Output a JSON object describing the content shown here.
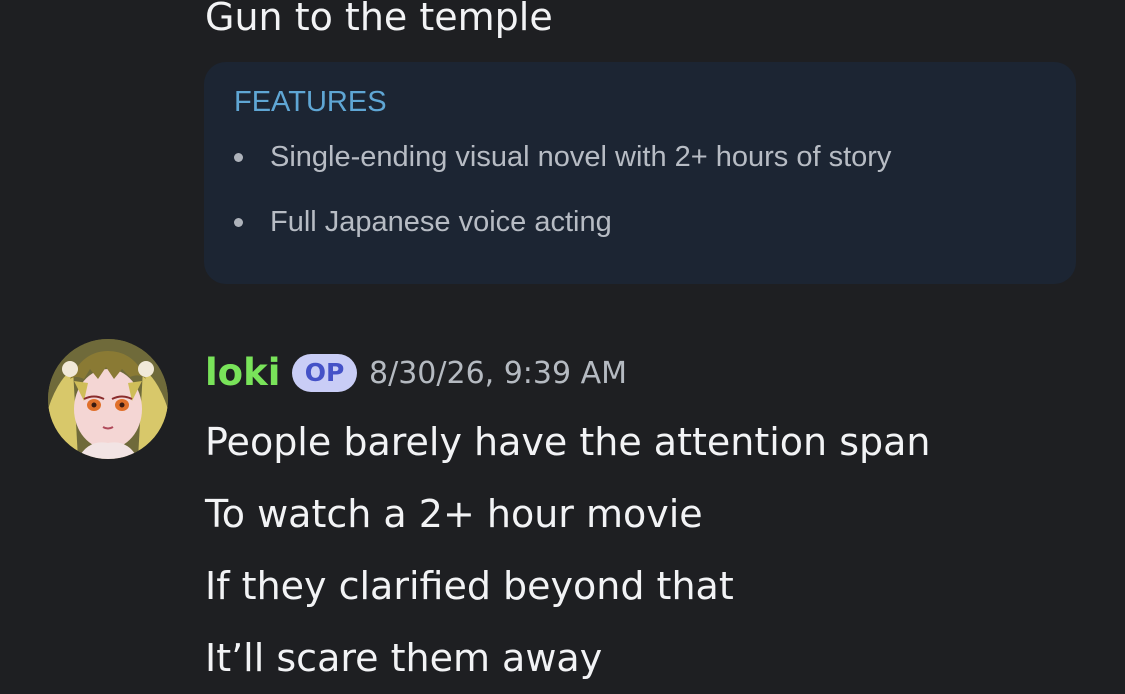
{
  "previous_message": {
    "last_line": "Gun to the temple"
  },
  "embed": {
    "title": "FEATURES",
    "features": [
      "Single-ending visual novel with 2+ hours of story",
      "Full Japanese voice acting"
    ]
  },
  "message": {
    "avatar_icon": "anime-girl-avatar",
    "username": "loki",
    "username_color": "#79e35a",
    "badge": "OP",
    "timestamp": "8/30/26, 9:39 AM",
    "lines": [
      "People barely have the attention span",
      "To watch a 2+ hour movie",
      "If they clarified beyond that",
      "It’ll scare them away"
    ]
  },
  "colors": {
    "background": "#1e1f22",
    "embed_background": "#1c2533",
    "embed_title": "#5fa6d4",
    "badge_background": "#c9cdf6",
    "badge_text": "#4451c7"
  }
}
